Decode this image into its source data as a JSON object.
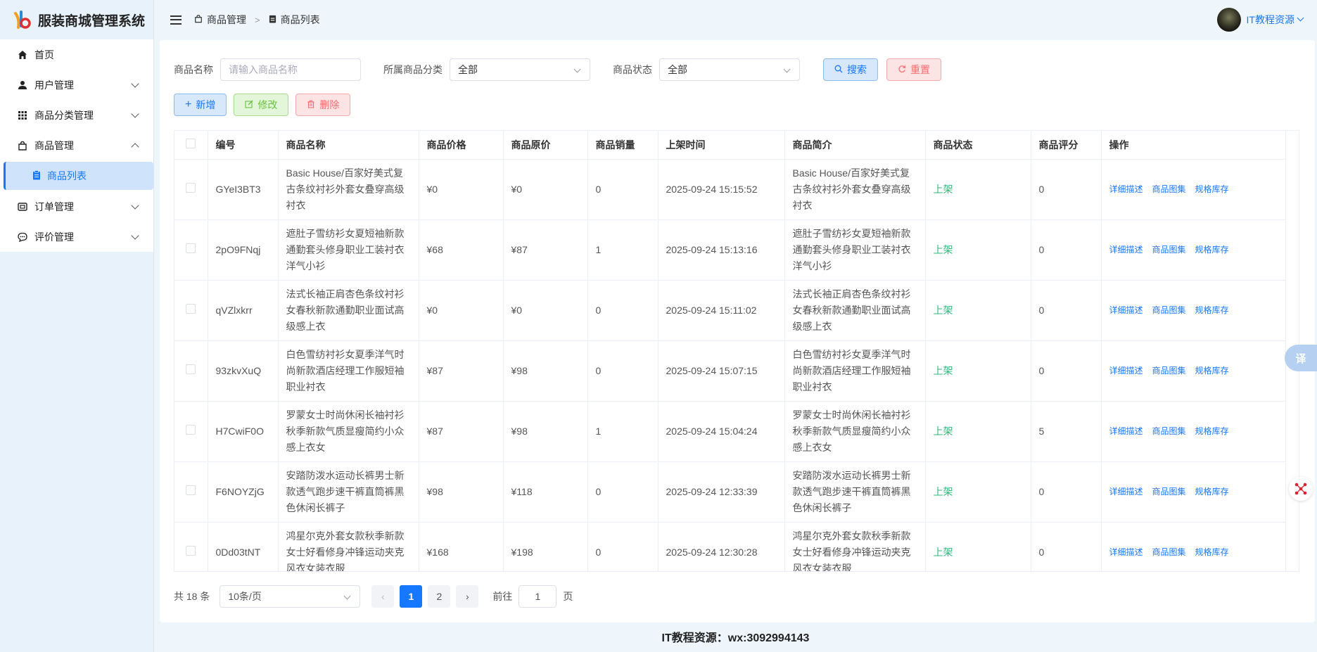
{
  "app": {
    "title": "服装商城管理系统"
  },
  "sidebar": {
    "items": [
      {
        "label": "首页",
        "icon": "home-icon"
      },
      {
        "label": "用户管理",
        "icon": "user-icon"
      },
      {
        "label": "商品分类管理",
        "icon": "grid-icon"
      },
      {
        "label": "商品管理",
        "icon": "bag-icon"
      },
      {
        "label": "商品列表",
        "icon": "clipboard-icon"
      },
      {
        "label": "订单管理",
        "icon": "order-icon"
      },
      {
        "label": "评价管理",
        "icon": "comment-icon"
      }
    ]
  },
  "header": {
    "breadcrumb": [
      "商品管理",
      "商品列表"
    ],
    "user_name": "IT教程资源"
  },
  "filters": {
    "name_label": "商品名称",
    "name_placeholder": "请输入商品名称",
    "category_label": "所属商品分类",
    "category_value": "全部",
    "status_label": "商品状态",
    "status_value": "全部",
    "search_label": "搜索",
    "reset_label": "重置"
  },
  "actions": {
    "add_label": "新增",
    "edit_label": "修改",
    "delete_label": "删除"
  },
  "table": {
    "columns": [
      "编号",
      "商品名称",
      "商品价格",
      "商品原价",
      "商品销量",
      "上架时间",
      "商品简介",
      "商品状态",
      "商品评分",
      "操作"
    ],
    "op_labels": [
      "详细描述",
      "商品图集",
      "规格库存"
    ],
    "rows": [
      {
        "id": "GYeI3BT3",
        "name": "Basic House/百家好美式复古条纹衬衫外套女叠穿高级衬衣",
        "price": "¥0",
        "orig": "¥0",
        "sales": "0",
        "time": "2025-09-24 15:15:52",
        "desc": "Basic House/百家好美式复古条纹衬衫外套女叠穿高级衬衣",
        "status": "上架",
        "score": "0"
      },
      {
        "id": "2pO9FNqj",
        "name": "遮肚子雪纺衫女夏短袖新款通勤套头修身职业工装衬衣洋气小衫",
        "price": "¥68",
        "orig": "¥87",
        "sales": "1",
        "time": "2025-09-24 15:13:16",
        "desc": "遮肚子雪纺衫女夏短袖新款通勤套头修身职业工装衬衣洋气小衫",
        "status": "上架",
        "score": "0"
      },
      {
        "id": "qVZlxkrr",
        "name": "法式长袖正肩杏色条纹衬衫女春秋新款通勤职业面试高级感上衣",
        "price": "¥0",
        "orig": "¥0",
        "sales": "0",
        "time": "2025-09-24 15:11:02",
        "desc": "法式长袖正肩杏色条纹衬衫女春秋新款通勤职业面试高级感上衣",
        "status": "上架",
        "score": "0"
      },
      {
        "id": "93zkvXuQ",
        "name": "白色雪纺衬衫女夏季洋气时尚新款酒店经理工作服短袖职业衬衣",
        "price": "¥87",
        "orig": "¥98",
        "sales": "0",
        "time": "2025-09-24 15:07:15",
        "desc": "白色雪纺衬衫女夏季洋气时尚新款酒店经理工作服短袖职业衬衣",
        "status": "上架",
        "score": "0"
      },
      {
        "id": "H7CwiF0O",
        "name": "罗蒙女士时尚休闲长袖衬衫秋季新款气质显瘦简约小众感上衣女",
        "price": "¥87",
        "orig": "¥98",
        "sales": "1",
        "time": "2025-09-24 15:04:24",
        "desc": "罗蒙女士时尚休闲长袖衬衫秋季新款气质显瘦简约小众感上衣女",
        "status": "上架",
        "score": "5"
      },
      {
        "id": "F6NOYZjG",
        "name": "安踏防泼水运动长裤男士新款透气跑步速干裤直筒裤黑色休闲长裤子",
        "price": "¥98",
        "orig": "¥118",
        "sales": "0",
        "time": "2025-09-24 12:33:39",
        "desc": "安踏防泼水运动长裤男士新款透气跑步速干裤直筒裤黑色休闲长裤子",
        "status": "上架",
        "score": "0"
      },
      {
        "id": "0Dd03tNT",
        "name": "鸿星尔克外套女款秋季新款女士好看修身冲锋运动夹克风衣女装衣服",
        "price": "¥168",
        "orig": "¥198",
        "sales": "0",
        "time": "2025-09-24 12:30:28",
        "desc": "鸿星尔克外套女款秋季新款女士好看修身冲锋运动夹克风衣女装衣服",
        "status": "上架",
        "score": "0"
      }
    ]
  },
  "pagination": {
    "total_text": "共 18 条",
    "page_size": "10条/页",
    "pages": [
      "1",
      "2"
    ],
    "current": "1",
    "goto_label": "前往",
    "goto_value": "1",
    "page_unit": "页"
  },
  "footer": {
    "text": "IT教程资源：wx:3092994143"
  },
  "floating": {
    "translate_label": "译"
  },
  "colors": {
    "primary": "#1677ff",
    "danger": "#f56c6c",
    "success": "#67c23a",
    "status_on": "#2aba7a"
  }
}
